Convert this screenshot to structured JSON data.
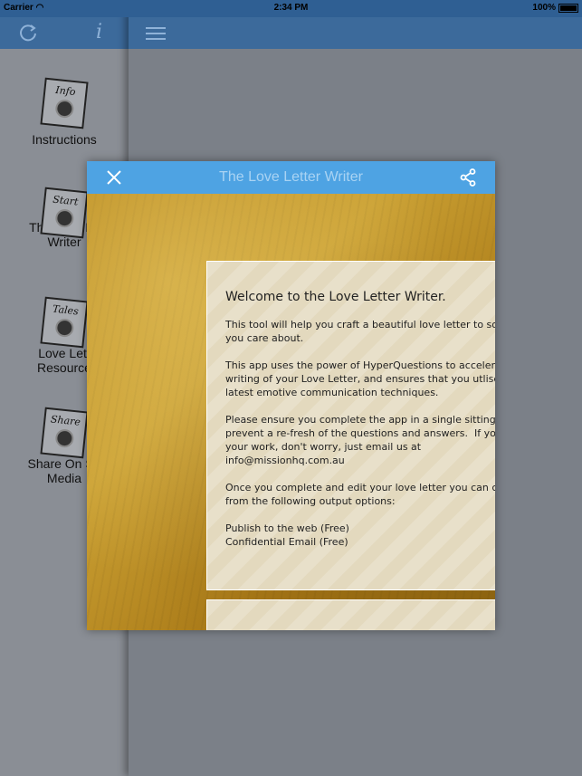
{
  "status_bar": {
    "carrier": "Carrier",
    "time": "2:34 PM",
    "battery": "100%"
  },
  "sidebar": {
    "items": [
      {
        "label": "Instructions",
        "tile_label": "Info",
        "icon": "info-tile-icon"
      },
      {
        "label": "The Love Le\nWriter",
        "tile_label": "Start",
        "icon": "start-tile-icon"
      },
      {
        "label": "Love Lett\nResource",
        "tile_label": "Tales",
        "icon": "tales-tile-icon"
      },
      {
        "label": "Share On So\nMedia",
        "tile_label": "Share",
        "icon": "share-tile-icon"
      }
    ]
  },
  "toolbar": {
    "refresh_icon": "refresh-icon",
    "info_icon": "info-icon",
    "menu_icon": "hamburger-menu-icon"
  },
  "modal": {
    "title": "The Love Letter Writer",
    "close_icon": "close-icon",
    "share_icon": "share-icon",
    "card": {
      "heading": "Welcome to the Love Letter Writer.",
      "paragraphs": [
        "This tool will help you craft a beautiful love letter to so\nyou care about.",
        "This app uses the power of HyperQuestions to accelera\nwriting of your Love Letter, and ensures that you utlise\nlatest emotive communication techniques.",
        "Please ensure you complete the app in a single sitting\nprevent a re-fresh of the questions and answers.  If yo\nyour work, don't worry, just email us at\ninfo@missionhq.com.au",
        "Once you complete and edit your love letter you can ch\nfrom the following output options:",
        "Publish to the web (Free)\nConfidential Email (Free)"
      ]
    }
  },
  "colors": {
    "nav_bar": "#3c6a9b",
    "modal_header": "#4ea3e3",
    "modal_title": "#a9d3f3"
  }
}
